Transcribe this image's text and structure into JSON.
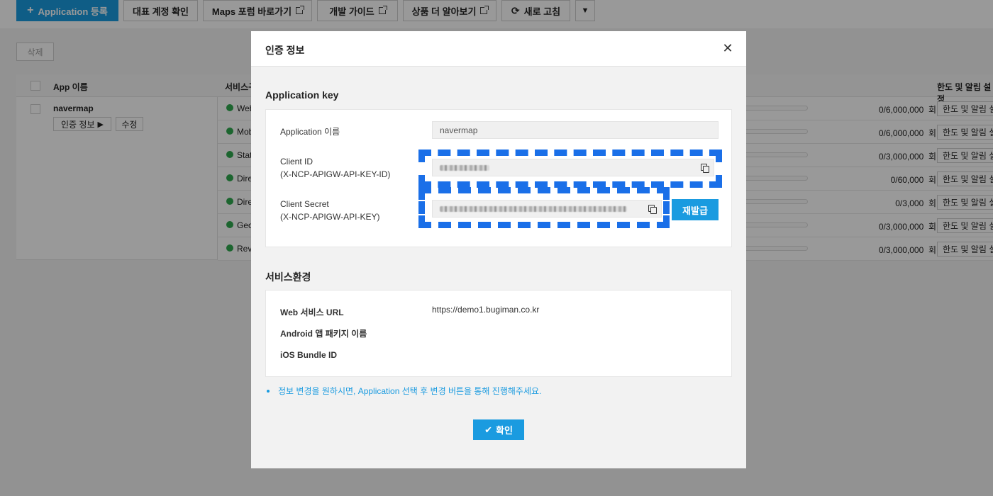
{
  "toolbar": {
    "buttons": [
      {
        "label": "Application 등록",
        "icon": "plus-icon"
      },
      {
        "label": "대표 계정 확인"
      },
      {
        "label": "Maps 포럼 바로가기",
        "icon": "external-link-icon"
      },
      {
        "label": "개발 가이드",
        "icon": "external-link-icon"
      },
      {
        "label": "상품 더 알아보기",
        "icon": "external-link-icon"
      },
      {
        "label": "새로 고침",
        "icon": "refresh-icon"
      }
    ],
    "more_icon": "chevron-down-icon"
  },
  "delete_button": "삭제",
  "table": {
    "col_app": "App 이름",
    "col_service": "서비스구",
    "col_limit": "한도 및 알림 설정",
    "app": {
      "name": "navermap",
      "auth_button": "인증 정보",
      "edit_button": "수정"
    },
    "rows": [
      {
        "service": "Web",
        "count": "0/6,000,000",
        "unit": "회",
        "limit": "한도 및 알림 설정"
      },
      {
        "service": "Mob",
        "count": "0/6,000,000",
        "unit": "회",
        "limit": "한도 및 알림 설정"
      },
      {
        "service": "Stat",
        "count": "0/3,000,000",
        "unit": "회",
        "limit": "한도 및 알림 설정"
      },
      {
        "service": "Dire",
        "count": "0/60,000",
        "unit": "회",
        "limit": "한도 및 알림 설정"
      },
      {
        "service": "Dire",
        "count": "0/3,000",
        "unit": "회",
        "limit": "한도 및 알림 설정"
      },
      {
        "service": "Geo",
        "count": "0/3,000,000",
        "unit": "회",
        "limit": "한도 및 알림 설정"
      },
      {
        "service": "Rev",
        "count": "0/3,000,000",
        "unit": "회",
        "limit": "한도 및 알림 설정"
      }
    ]
  },
  "modal": {
    "title": "인증 정보",
    "close_icon": "close-icon",
    "app_key_section": {
      "title": "Application key",
      "app_name_label": "Application 이름",
      "app_name_value": "navermap",
      "client_id_label": "Client ID",
      "client_id_sub": "(X-NCP-APIGW-API-KEY-ID)",
      "client_secret_label": "Client Secret",
      "client_secret_sub": "(X-NCP-APIGW-API-KEY)",
      "reissue_button": "재발급"
    },
    "service_env_section": {
      "title": "서비스환경",
      "web_url_label": "Web 서비스 URL",
      "web_url_value": "https://demo1.bugiman.co.kr",
      "android_label": "Android 앱 패키지 이름",
      "ios_label": "iOS Bundle ID"
    },
    "note": "정보 변경을 원하시면, Application 선택 후 변경 버튼을 통해 진행해주세요.",
    "ok_button": "확인"
  },
  "colors": {
    "accent": "#1a9be0",
    "highlight_dash": "#1a6fe8",
    "overlay": "rgba(0,0,0,0.40)"
  }
}
